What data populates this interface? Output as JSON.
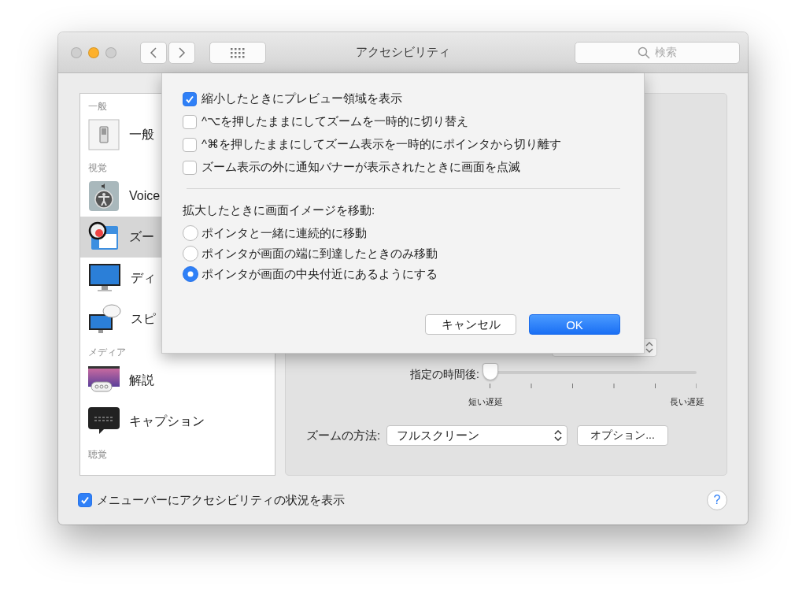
{
  "window": {
    "title": "アクセシビリティ"
  },
  "toolbar": {
    "search_placeholder": "検索"
  },
  "sidebar": [
    {
      "header": "一般",
      "items": [
        {
          "label": "一般",
          "selected": false
        }
      ]
    },
    {
      "header": "視覚",
      "items": [
        {
          "label": "Voice",
          "selected": false
        },
        {
          "label": "ズー",
          "selected": true
        },
        {
          "label": "ディ",
          "selected": false
        },
        {
          "label": "スピ",
          "selected": false
        }
      ]
    },
    {
      "header": "メディア",
      "items": [
        {
          "label": "解説",
          "selected": false
        },
        {
          "label": "キャプション",
          "selected": false
        }
      ]
    },
    {
      "header": "聴覚"
    }
  ],
  "content": {
    "delay": {
      "label": "指定の時間後:",
      "level": 0,
      "min_label": "短い遅延",
      "max_label": "長い遅延"
    },
    "zoom_method": {
      "label": "ズームの方法:",
      "value": "フルスクリーン"
    },
    "options_button": "オプション..."
  },
  "show_status": {
    "label": "メニューバーにアクセシビリティの状況を表示",
    "checked": true
  },
  "help_button": "?",
  "sheet": {
    "checkboxes": [
      {
        "label": "縮小したときにプレビュー領域を表示",
        "checked": true
      },
      {
        "label": "^⌥を押したままにしてズームを一時的に切り替え",
        "checked": false
      },
      {
        "label": "^⌘を押したままにしてズーム表示を一時的にポインタから切り離す",
        "checked": false
      },
      {
        "label": "ズーム表示の外に通知バナーが表示されたときに画面を点滅",
        "checked": false
      }
    ],
    "move_label": "拡大したときに画面イメージを移動:",
    "radios": [
      {
        "label": "ポインタと一緒に連続的に移動",
        "selected": false
      },
      {
        "label": "ポインタが画面の端に到達したときのみ移動",
        "selected": false
      },
      {
        "label": "ポインタが画面の中央付近にあるようにする",
        "selected": true
      }
    ],
    "cancel": "キャンセル",
    "ok": "OK"
  }
}
